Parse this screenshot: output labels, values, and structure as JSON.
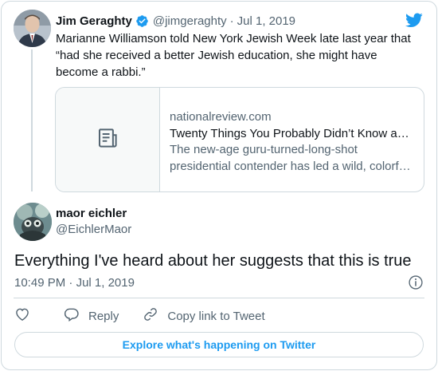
{
  "parent_tweet": {
    "name": "Jim Geraghty",
    "handle": "@jimgeraghty",
    "separator": "·",
    "date": "Jul 1, 2019",
    "text": "Marianne Williamson told New York Jewish Week late last year that “had she received a better Jewish education, she might have become a rabbi.”",
    "verified_icon": "verified-badge-icon",
    "link_card": {
      "domain": "nationalreview.com",
      "title": "Twenty Things You Probably Didn’t Know a…",
      "description_line1": "The new-age guru-turned-long-shot",
      "description_line2": "presidential contender has led a wild, colorf…",
      "thumbnail_icon": "article-icon"
    }
  },
  "tweet": {
    "name": "maor eichler",
    "handle": "@EichlerMaor",
    "text": "Everything I've heard about her suggests that this is true",
    "time": "10:49 PM",
    "separator": "·",
    "date": "Jul 1, 2019",
    "info_icon": "info-icon"
  },
  "actions": {
    "like_icon": "heart-icon",
    "reply_label": "Reply",
    "copy_label": "Copy link to Tweet"
  },
  "explore_label": "Explore what's happening on Twitter",
  "colors": {
    "accent": "#1d9bf0",
    "text_primary": "#0f1419",
    "text_secondary": "#536471",
    "border": "#cfd9de"
  }
}
